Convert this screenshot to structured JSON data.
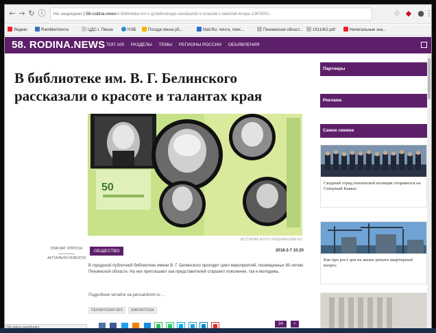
{
  "browser": {
    "url_security": "Не защищено",
    "url_host": "58.rodina.news",
    "url_path": "/v-biblioteke-im-v-g-belinskogo-rasskazali-o-krasote-i-talantah-kraya-13K0001..."
  },
  "bookmarks": [
    {
      "label": "Яндекс",
      "color": "#e8242b"
    },
    {
      "label": "Rambler/почта",
      "color": "#3b6ec2"
    },
    {
      "label": "ЦДС-г. Пенза",
      "color": "#cccccc"
    },
    {
      "label": "НЭБ",
      "color": "#2a8cd6"
    },
    {
      "label": "Погода пенза р5...",
      "color": "#f4b400"
    },
    {
      "label": "Mail.Ru: почта, поис...",
      "color": "#2b6fcc"
    },
    {
      "label": "Пензенская област...",
      "color": "#bbbbbb"
    },
    {
      "label": "1911/6/2.pdf",
      "color": "#bbbbbb"
    },
    {
      "label": "Нелегальные зна...",
      "color": "#e8242b"
    }
  ],
  "site": {
    "logo": "58. RODINA.NEWS",
    "nav": [
      "ТОП 100",
      "РАЗДЕЛЫ",
      "ТЕМЫ",
      "РЕГИОНЫ РОССИИ",
      "ОБЪЯВЛЕНИЯ"
    ]
  },
  "article": {
    "title": "В библиотеке им. В. Г. Белинского рассказали о красоте и талантах края",
    "photo_caption": "ИСТОЧНИК ФОТО: PENZAINFORM.RU",
    "left_meta_1": "ПЛАГИАТ ОПРОСЫ",
    "left_meta_2": "АКТУАЛЬНО НОВОСТИ",
    "section_tag": "ОБЩЕСТВО",
    "date": "2018-2-7 10:20",
    "excerpt": "В городской публичной библиотеке имени В. Г. Белинского проходит цикл мероприятий, посвященных 80-летию Пензенской области. На них приглашают как представителей старшего поколения, так и молодежь.",
    "read_more": "Подробнее читайте на penzainform.ru ...",
    "tags": [
      "ПЕНЗЕНСКАЯ ОБЛ",
      "БИБЛИОТЕКА"
    ],
    "share_count": "24",
    "share_more": "+"
  },
  "sidebar": {
    "partners": "Партнеры",
    "ads": "Реклама",
    "latest": "Самое свежее",
    "cards": [
      {
        "text": "Сводный отряд пензенской полиции отправился на Северный Кавказ"
      },
      {
        "text": "Как про рост цен на жилье решать квартирный вопрос"
      }
    ]
  },
  "status": {
    "text": "58.rodina.news/login/"
  },
  "colors": {
    "brand": "#5d1f6a"
  }
}
